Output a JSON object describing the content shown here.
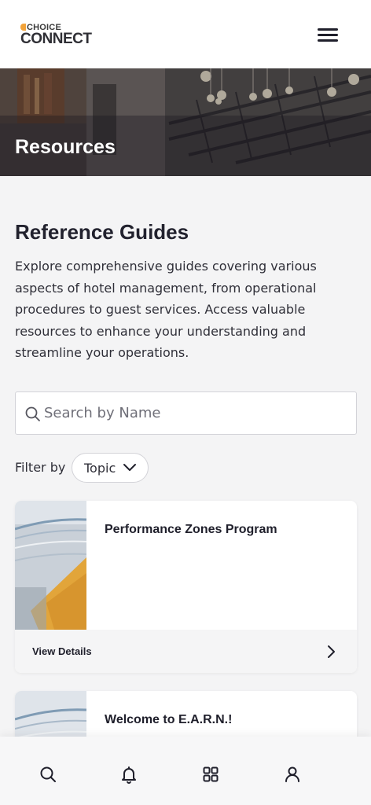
{
  "header": {
    "logo_top": "CHOICE",
    "logo_bottom": "CONNECT"
  },
  "hero": {
    "title": "Resources"
  },
  "main": {
    "title": "Reference Guides",
    "description": "Explore comprehensive guides covering various aspects of hotel management, from operational procedures to guest services. Access valuable resources to enhance your understanding and streamline your operations.",
    "search": {
      "placeholder": "Search by Name"
    },
    "filter": {
      "label": "Filter by",
      "selected": "Topic"
    }
  },
  "cards": [
    {
      "title": "Performance Zones Program",
      "action": "View Details"
    },
    {
      "title": "Welcome to E.A.R.N.!"
    }
  ],
  "bottom_nav": [
    "search-icon",
    "bell-icon",
    "grid-icon",
    "user-icon"
  ],
  "colors": {
    "accent": "#f2a33a",
    "text": "#1f1f2b",
    "background": "#f4f4f5"
  }
}
